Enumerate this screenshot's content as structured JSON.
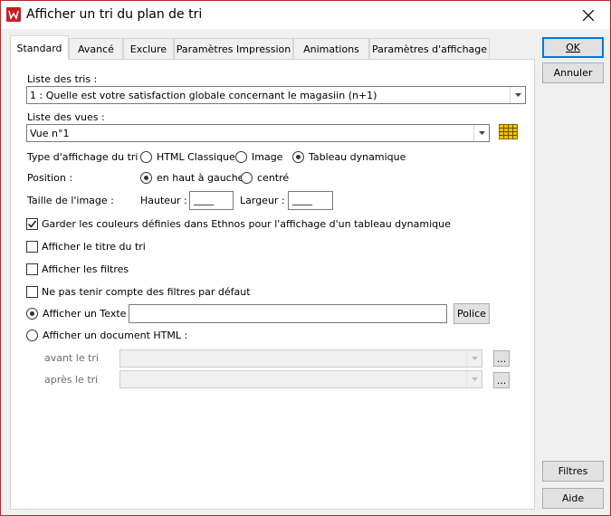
{
  "window": {
    "title": "Afficher un tri du plan de tri"
  },
  "tabs": [
    {
      "label": "Standard"
    },
    {
      "label": "Avancé"
    },
    {
      "label": "Exclure"
    },
    {
      "label": "Paramètres Impression"
    },
    {
      "label": "Animations"
    },
    {
      "label": "Paramètres d'affichage"
    }
  ],
  "buttons": {
    "ok": "OK",
    "annuler": "Annuler",
    "filtres": "Filtres",
    "aide": "Aide",
    "police": "Police",
    "browse": "..."
  },
  "form": {
    "liste_tris_label": "Liste des tris :",
    "liste_tris_value": "1 : Quelle est votre satisfaction globale concernant le magasiin (n+1)",
    "liste_vues_label": "Liste des vues :",
    "liste_vues_value": "Vue n°1",
    "type_affichage_label": "Type d'affichage du tri :",
    "type_options": [
      "HTML Classique",
      "Image",
      "Tableau dynamique"
    ],
    "type_selected": "Tableau dynamique",
    "position_label": "Position :",
    "position_options": [
      "en haut à gauche",
      "centré"
    ],
    "position_selected": "en haut à gauche",
    "taille_label": "Taille de l'image :",
    "hauteur_label": "Hauteur :",
    "hauteur_value": "____",
    "largeur_label": "Largeur :",
    "largeur_value": "____",
    "garder_couleurs": "Garder les couleurs définies dans Ethnos pour l'affichage d'un tableau dynamique",
    "garder_couleurs_checked": true,
    "afficher_titre": "Afficher le titre du tri",
    "afficher_titre_checked": false,
    "afficher_filtres": "Afficher les filtres",
    "afficher_filtres_checked": false,
    "ne_pas_tenir": "Ne pas tenir compte des filtres par défaut",
    "ne_pas_tenir_checked": false,
    "afficher_texte": "Afficher un Texte",
    "afficher_texte_selected": true,
    "texte_value": "",
    "afficher_document": "Afficher un document HTML :",
    "avant_label": "avant le tri",
    "apres_label": "après le tri"
  },
  "colors": {
    "accent": "#0078d7",
    "title_border": "#b52a2a",
    "app_icon": "#c81e1e",
    "grid_icon": "#f2c200"
  }
}
